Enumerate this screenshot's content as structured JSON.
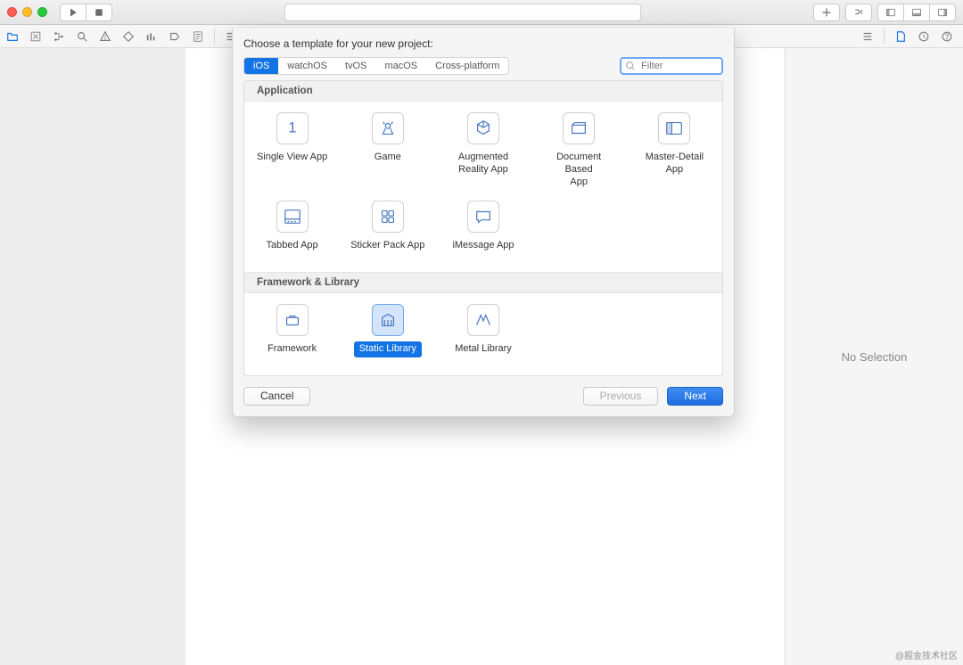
{
  "toolbar": {
    "traffic": [
      "close",
      "minimize",
      "zoom"
    ]
  },
  "inspector": {
    "empty_label": "No Selection"
  },
  "sheet": {
    "title": "Choose a template for your new project:",
    "platforms": [
      "iOS",
      "watchOS",
      "tvOS",
      "macOS",
      "Cross-platform"
    ],
    "platform_selected": 0,
    "filter_placeholder": "Filter",
    "sections": [
      {
        "title": "Application",
        "items": [
          {
            "label": "Single View App",
            "icon": "single-view"
          },
          {
            "label": "Game",
            "icon": "game"
          },
          {
            "label": "Augmented\nReality App",
            "icon": "ar"
          },
          {
            "label": "Document Based\nApp",
            "icon": "document"
          },
          {
            "label": "Master-Detail App",
            "icon": "master-detail"
          },
          {
            "label": "Tabbed App",
            "icon": "tabbed"
          },
          {
            "label": "Sticker Pack App",
            "icon": "sticker"
          },
          {
            "label": "iMessage App",
            "icon": "imessage"
          }
        ]
      },
      {
        "title": "Framework & Library",
        "items": [
          {
            "label": "Framework",
            "icon": "framework"
          },
          {
            "label": "Static Library",
            "icon": "library",
            "selected": true
          },
          {
            "label": "Metal Library",
            "icon": "metal"
          }
        ]
      }
    ],
    "buttons": {
      "cancel": "Cancel",
      "previous": "Previous",
      "next": "Next"
    }
  },
  "watermark": "@掘金技术社区"
}
